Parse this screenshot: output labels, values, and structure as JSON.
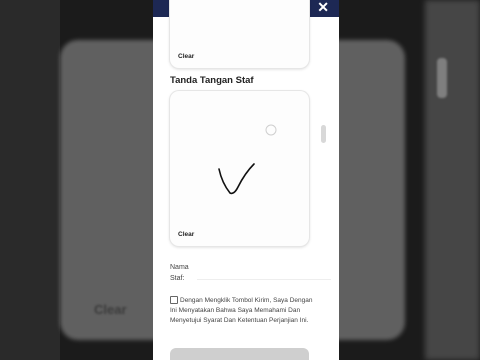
{
  "backdrop": {
    "clear_label": "Clear"
  },
  "modal": {
    "close_symbol": "✕",
    "top_pad": {
      "clear_label": "Clear"
    },
    "staff_signature": {
      "title": "Tanda Tangan Staf",
      "clear_label": "Clear"
    },
    "name_field": {
      "label_line1": "Nama",
      "label_line2": "Staf:",
      "value": ""
    },
    "agreement": {
      "checked": false,
      "text": "Dengan Mengklik Tombol Kirim, Saya Dengan Ini Menyatakan Bahwa Saya Memahami Dan Menyetujui Syarat Dan Ketentuan Perjanjian Ini."
    }
  },
  "colors": {
    "header": "#1d2854",
    "page_background": "#1b1b1b",
    "modal_background": "#ffffff"
  }
}
